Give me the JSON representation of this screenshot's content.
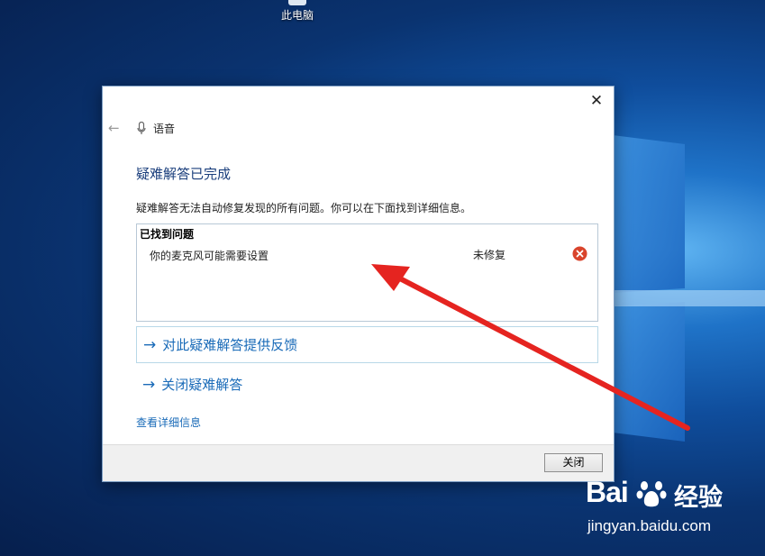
{
  "desktop": {
    "icon_label": "此电脑"
  },
  "dialog": {
    "close_icon": "close-icon",
    "back_icon": "back-arrow-icon",
    "app_icon": "microphone-icon",
    "app_title": "语音",
    "heading": "疑难解答已完成",
    "description": "疑难解答无法自动修复发现的所有问题。你可以在下面找到详细信息。",
    "problems": {
      "header": "已找到问题",
      "items": [
        {
          "label": "你的麦克风可能需要设置",
          "status": "未修复",
          "status_icon": "error-icon"
        }
      ]
    },
    "feedback_link": "对此疑难解答提供反馈",
    "close_troubleshooter_link": "关闭疑难解答",
    "details_link": "查看详细信息",
    "close_button": "关闭"
  },
  "watermark": {
    "brand_left": "Bai",
    "brand_right": "经验",
    "url": "jingyan.baidu.com"
  },
  "colors": {
    "link": "#1a6bb8",
    "heading": "#1a3e7c",
    "annotation_arrow": "#e52420",
    "error_icon": "#d9442c"
  }
}
